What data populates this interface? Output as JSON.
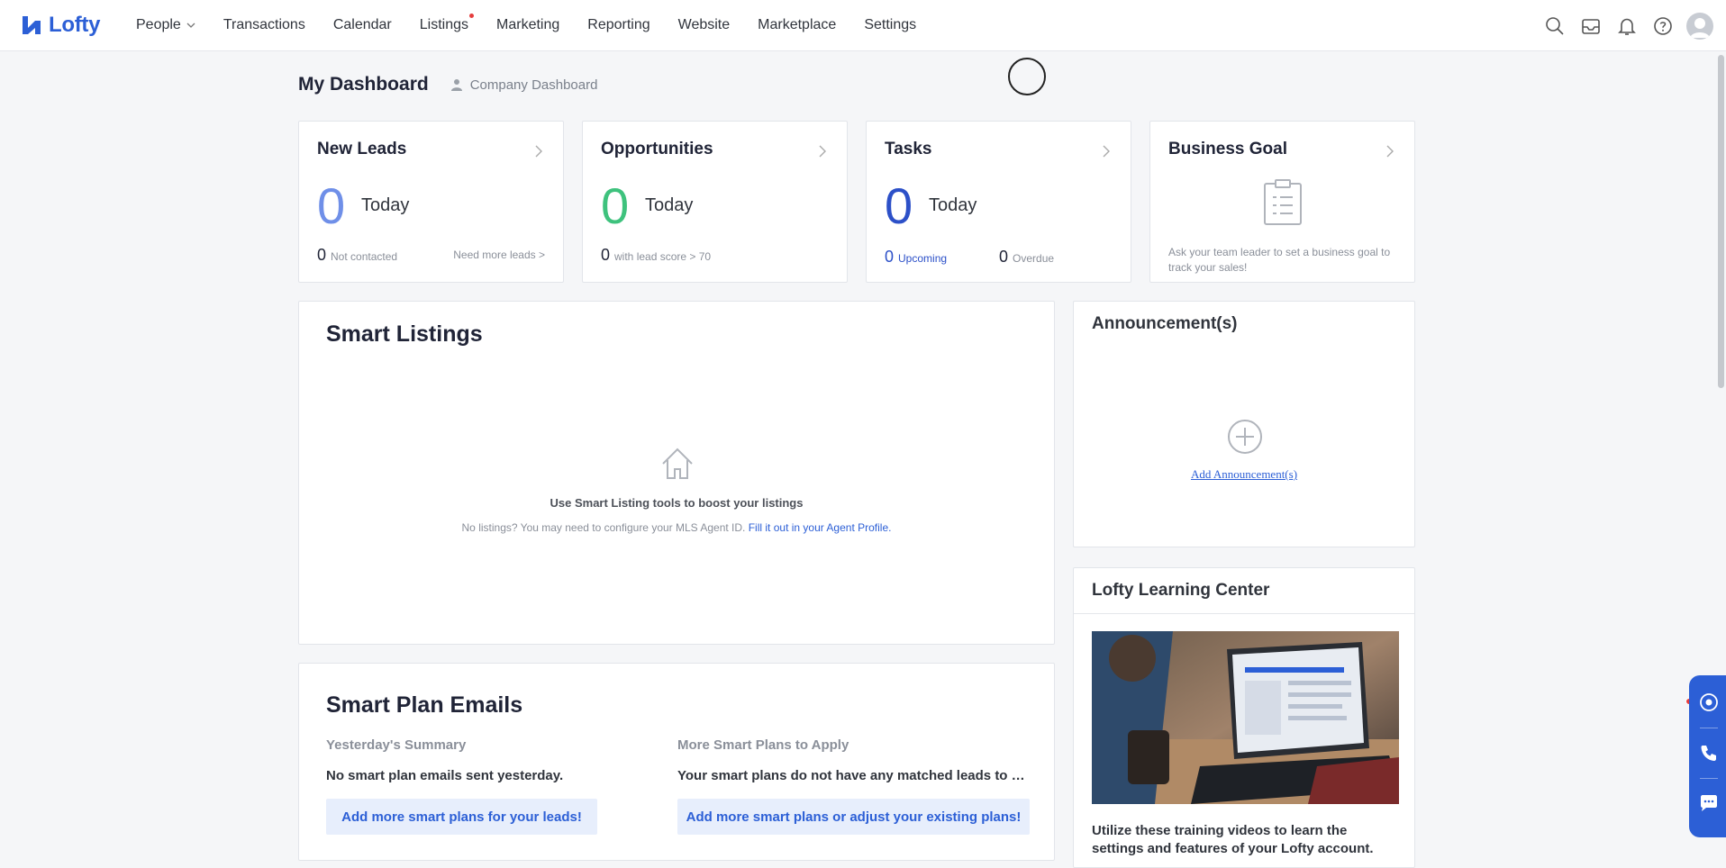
{
  "brand": {
    "name": "Lofty",
    "color": "#2c5fd6"
  },
  "nav": {
    "items": [
      {
        "label": "People",
        "has_dropdown": true
      },
      {
        "label": "Transactions"
      },
      {
        "label": "Calendar"
      },
      {
        "label": "Listings",
        "has_badge": true
      },
      {
        "label": "Marketing"
      },
      {
        "label": "Reporting"
      },
      {
        "label": "Website"
      },
      {
        "label": "Marketplace"
      },
      {
        "label": "Settings"
      }
    ],
    "right_icons": [
      "search-icon",
      "inbox-icon",
      "bell-icon",
      "help-icon",
      "avatar"
    ]
  },
  "header": {
    "title": "My Dashboard",
    "company_link": "Company Dashboard"
  },
  "stats": {
    "new_leads": {
      "title": "New Leads",
      "count": "0",
      "period": "Today",
      "sub_count": "0",
      "sub_label": "Not contacted",
      "action": "Need more leads >",
      "color": "#6f8fe8"
    },
    "opportunities": {
      "title": "Opportunities",
      "count": "0",
      "period": "Today",
      "sub_count": "0",
      "sub_label": "with lead score > 70",
      "color": "#3ec27d"
    },
    "tasks": {
      "title": "Tasks",
      "count": "0",
      "period": "Today",
      "upcoming_count": "0",
      "upcoming_label": "Upcoming",
      "overdue_count": "0",
      "overdue_label": "Overdue",
      "color": "#2c50c8"
    },
    "business_goal": {
      "title": "Business Goal",
      "text": "Ask your team leader to set a business goal to track your sales!"
    }
  },
  "smart_listings": {
    "title": "Smart Listings",
    "empty_title": "Use Smart Listing tools to boost your listings",
    "empty_text": "No listings? You may need to configure your MLS Agent ID.",
    "empty_link": "Fill it out in your Agent Profile."
  },
  "announcements": {
    "title": "Announcement(s)",
    "add_link": "Add Announcement(s)"
  },
  "smart_plan": {
    "title": "Smart Plan Emails",
    "left": {
      "title": "Yesterday's Summary",
      "text": "No smart plan emails sent yesterday.",
      "button": "Add more smart plans for your leads!"
    },
    "right": {
      "title": "More Smart Plans to Apply",
      "text": "Your smart plans do not have any matched leads to apply.",
      "button": "Add more smart plans or adjust your existing plans!"
    }
  },
  "learning_center": {
    "title": "Lofty Learning Center",
    "text": "Utilize these training videos to learn the settings and features of your Lofty account."
  }
}
